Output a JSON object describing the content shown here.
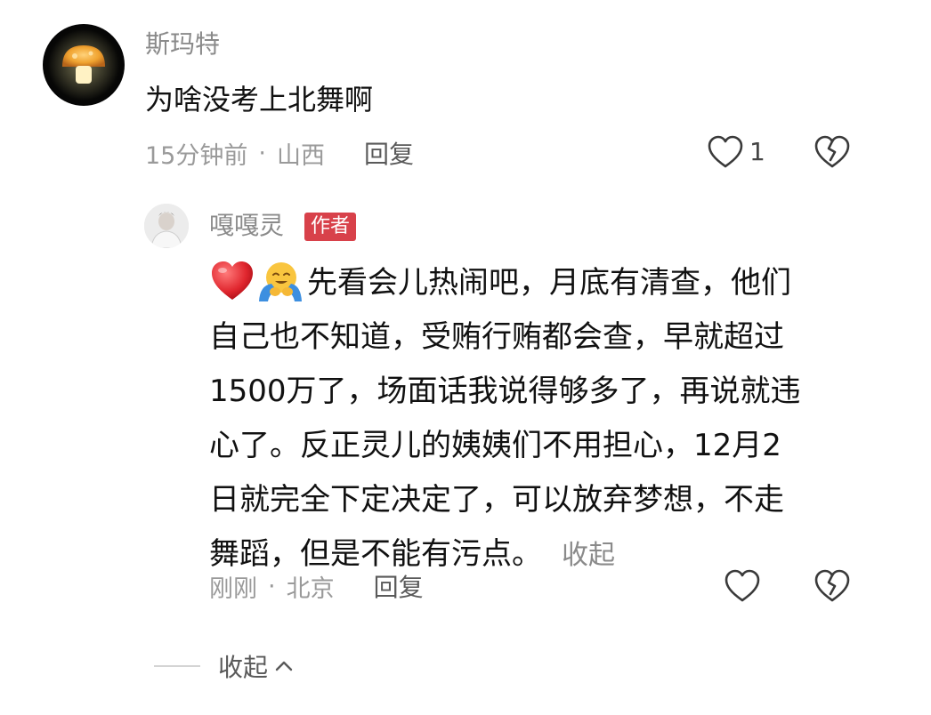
{
  "comment": {
    "username": "斯玛特",
    "text": "为啥没考上北舞啊",
    "time": "15分钟前",
    "separator": "·",
    "location": "山西",
    "reply_label": "回复",
    "like_count": "1",
    "avatar_icon": "mushroom-avatar-icon"
  },
  "reply": {
    "username": "嘎嘎灵",
    "badge": "作者",
    "emojis": [
      "red-heart-emoji",
      "hugging-face-emoji"
    ],
    "lines": [
      "先看会儿热闹吧，月底有清查，他们",
      "自己也不知道，受贿行贿都会查，早就超过",
      "1500万了，场面话我说得够多了，再说就违",
      "心了。反正灵儿的姨姨们不用担心，12月2",
      "日就完全下定决定了，可以放弃梦想，不走",
      "舞蹈，但是不能有污点。"
    ],
    "collapse_inline": "收起",
    "time": "刚刚",
    "separator": "·",
    "location": "北京",
    "reply_label": "回复"
  },
  "thread": {
    "collapse_label": "收起"
  },
  "colors": {
    "badge": "#d8414a",
    "meta_text": "#9a9a9a",
    "body_text": "#111111"
  }
}
